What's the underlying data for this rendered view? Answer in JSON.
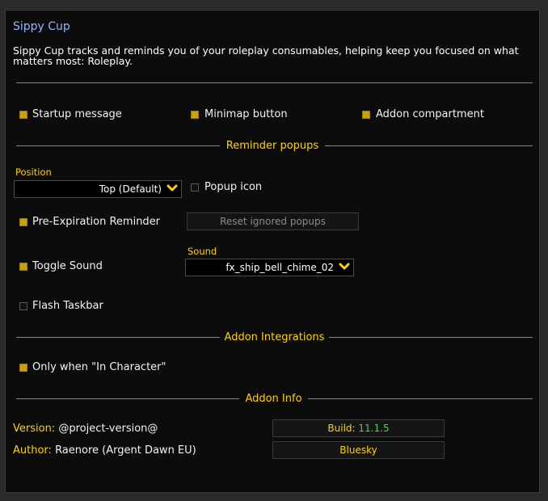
{
  "title": "Sippy Cup",
  "description": "Sippy Cup tracks and reminds you of your roleplay consumables, helping keep you focused on what matters most: Roleplay.",
  "general": {
    "startup_message": {
      "label": "Startup message",
      "checked": true
    },
    "minimap_button": {
      "label": "Minimap button",
      "checked": true
    },
    "addon_compartment": {
      "label": "Addon compartment",
      "checked": true
    }
  },
  "reminder_popups": {
    "header": "Reminder popups",
    "position_label": "Position",
    "position_value": "Top (Default)",
    "popup_icon": {
      "label": "Popup icon",
      "checked": false
    },
    "pre_expiration": {
      "label": "Pre-Expiration Reminder",
      "checked": true
    },
    "reset_button": "Reset ignored popups",
    "toggle_sound": {
      "label": "Toggle Sound",
      "checked": true
    },
    "sound_label": "Sound",
    "sound_value": "fx_ship_bell_chime_02",
    "flash_taskbar": {
      "label": "Flash Taskbar",
      "checked": false
    }
  },
  "integrations": {
    "header": "Addon Integrations",
    "in_character": {
      "label": "Only when \"In Character\"",
      "checked": true
    }
  },
  "info": {
    "header": "Addon Info",
    "version_label": "Version:",
    "version_value": "@project-version@",
    "author_label": "Author:",
    "author_value": "Raenore (Argent Dawn EU)",
    "build_label": "Build:",
    "build_value": "11.1.5",
    "bluesky_label": "Bluesky"
  },
  "colors": {
    "accent": "#ffd100",
    "title": "#8fb3ff",
    "build_green": "#3fdb3f",
    "checkbox_on": "#c9a10c"
  }
}
